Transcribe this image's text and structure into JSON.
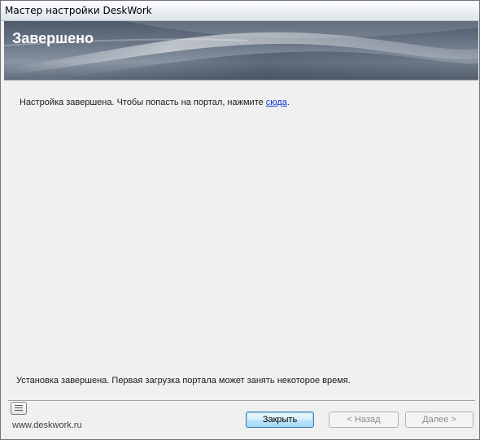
{
  "window": {
    "title": "Мастер настройки DeskWork"
  },
  "banner": {
    "title": "Завершено"
  },
  "content": {
    "message_prefix": "Настройка завершена. Чтобы попасть на портал, нажмите ",
    "link_text": "сюда",
    "message_suffix": "."
  },
  "status": {
    "text": "Установка завершена. Первая загрузка портала может занять некоторое время."
  },
  "footer": {
    "site_text": "www.deskwork.ru",
    "info_icon": "notes-icon"
  },
  "buttons": {
    "close_label": "Закрыть",
    "back_label": "< Назад",
    "next_label": "Далее >"
  },
  "colors": {
    "link": "#1432d6",
    "banner_dark": "#4e5a6b",
    "default_button_border": "#3c7fb1"
  }
}
